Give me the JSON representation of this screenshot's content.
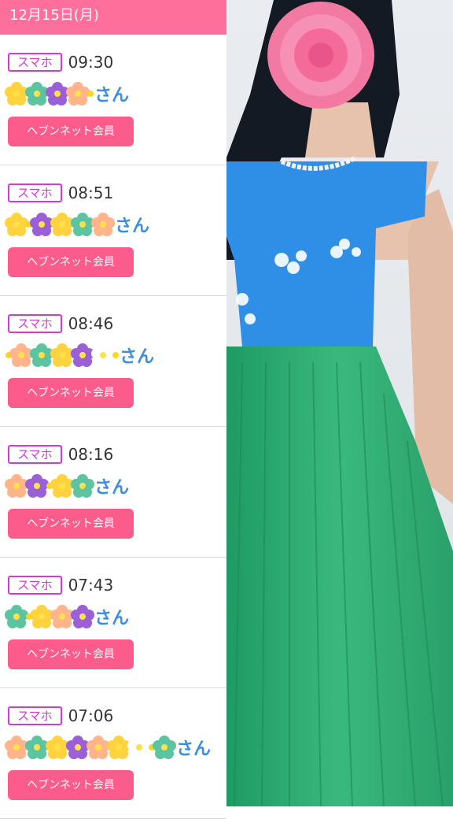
{
  "header": {
    "date": "12月15日(月)"
  },
  "entries": [
    {
      "badge": "スマホ",
      "time": "09:30",
      "suffix": "さん",
      "member": "ヘブンネット会員",
      "flowers": [
        "yellow",
        "green",
        "purple",
        "peach",
        "dot"
      ]
    },
    {
      "badge": "スマホ",
      "time": "08:51",
      "suffix": "さん",
      "member": "ヘブンネット会員",
      "flowers": [
        "yellow",
        "dot",
        "purple",
        "yellow",
        "green",
        "peach"
      ]
    },
    {
      "badge": "スマホ",
      "time": "08:46",
      "suffix": "さん",
      "member": "ヘブンネット会員",
      "flowers": [
        "dot",
        "peach",
        "green",
        "yellow",
        "purple",
        "white",
        "dot"
      ]
    },
    {
      "badge": "スマホ",
      "time": "08:16",
      "suffix": "さん",
      "member": "ヘブンネット会員",
      "flowers": [
        "peach",
        "purple",
        "dot",
        "yellow",
        "green"
      ]
    },
    {
      "badge": "スマホ",
      "time": "07:43",
      "suffix": "さん",
      "member": "ヘブンネット会員",
      "flowers": [
        "green",
        "dot",
        "yellow",
        "peach",
        "purple"
      ]
    },
    {
      "badge": "スマホ",
      "time": "07:06",
      "suffix": "さん",
      "member": "ヘブンネット会員",
      "flowers": [
        "peach",
        "green",
        "yellow",
        "purple",
        "peach",
        "yellow",
        "white",
        "dot",
        "green"
      ]
    }
  ],
  "photo": {
    "description_icon": "profile-photo"
  },
  "colors": {
    "header": "#ff6f9c",
    "badge_border": "#d23bd2",
    "member_button": "#fb5c8c",
    "san_text": "#3a8ee0",
    "flower_yellow": "#ffd23f",
    "flower_green": "#5cc4a0",
    "flower_purple": "#9b5fd6",
    "flower_peach": "#ffb48a",
    "flower_white": "#ffffff"
  }
}
